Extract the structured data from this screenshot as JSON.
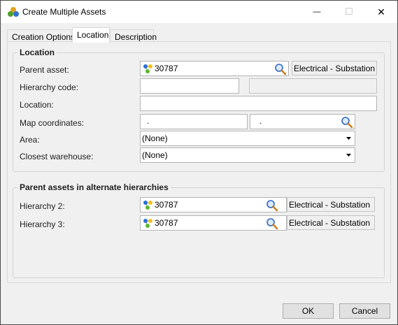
{
  "window": {
    "title": "Create Multiple Assets",
    "minimize_glyph": "—",
    "maximize_glyph": "☐",
    "close_glyph": "✕"
  },
  "tabs": [
    {
      "label": "Creation Options",
      "active": false
    },
    {
      "label": "Location",
      "active": true
    },
    {
      "label": "Description",
      "active": false
    }
  ],
  "location": {
    "group_title": "Location",
    "parent_asset": {
      "label": "Parent asset:",
      "value": "30787",
      "type": "Electrical - Substation"
    },
    "hierarchy_code": {
      "label": "Hierarchy code:",
      "value": "",
      "readonly_value": ""
    },
    "location": {
      "label": "Location:",
      "value": ""
    },
    "map_coordinates": {
      "label": "Map coordinates:",
      "x": ".",
      "y": "."
    },
    "area": {
      "label": "Area:",
      "value": "(None)"
    },
    "closest_warehouse": {
      "label": "Closest warehouse:",
      "value": "(None)"
    }
  },
  "alternate": {
    "group_title": "Parent assets in alternate hierarchies",
    "hierarchy2": {
      "label": "Hierarchy 2:",
      "value": "30787",
      "type": "Electrical - Substation"
    },
    "hierarchy3": {
      "label": "Hierarchy 3:",
      "value": "30787",
      "type": "Electrical - Substation"
    }
  },
  "buttons": {
    "ok": "OK",
    "cancel": "Cancel"
  },
  "icons": {
    "app": "assets-cluster-icon",
    "asset": "asset-node-icon",
    "lookup": "magnifier-icon",
    "dropdown": "dropdown-arrow-icon"
  },
  "colors": {
    "accent_blue": "#2a6fd6",
    "asset_green": "#5cb82e",
    "asset_yellow": "#f2c21b"
  }
}
